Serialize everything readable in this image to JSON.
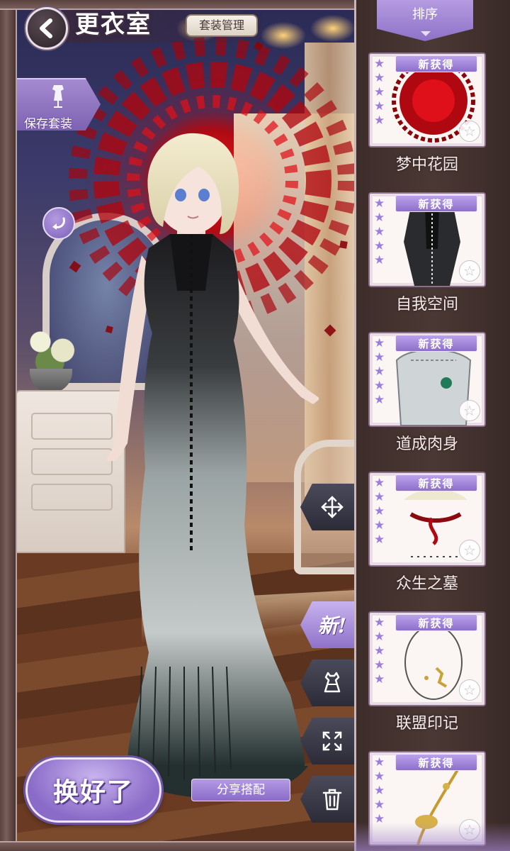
{
  "header": {
    "title": "更衣室",
    "suit_manage_label": "套装管理"
  },
  "left_tools": {
    "save_suit_label": "保存套装"
  },
  "right_tools": {
    "new_label": "新!"
  },
  "bottom": {
    "done_label": "换好了",
    "share_label": "分享搭配"
  },
  "panel": {
    "sort_label": "排序",
    "items": [
      {
        "name": "梦中花园",
        "badge": "新获得",
        "stars": 5,
        "thumb": "red-halo"
      },
      {
        "name": "自我空间",
        "badge": "新获得",
        "stars": 5,
        "thumb": "black-dress"
      },
      {
        "name": "道成肉身",
        "badge": "新获得",
        "stars": 5,
        "thumb": "silver-top"
      },
      {
        "name": "众生之墓",
        "badge": "新获得",
        "stars": 5,
        "thumb": "red-choker"
      },
      {
        "name": "联盟印记",
        "badge": "新获得",
        "stars": 5,
        "thumb": "face-mark"
      },
      {
        "name": "",
        "badge": "新获得",
        "stars": 5,
        "thumb": "gold-chain"
      }
    ]
  },
  "colors": {
    "accent_purple": "#8d71c8",
    "panel_bg": "#4a3834",
    "halo_red": "#d40a14"
  }
}
